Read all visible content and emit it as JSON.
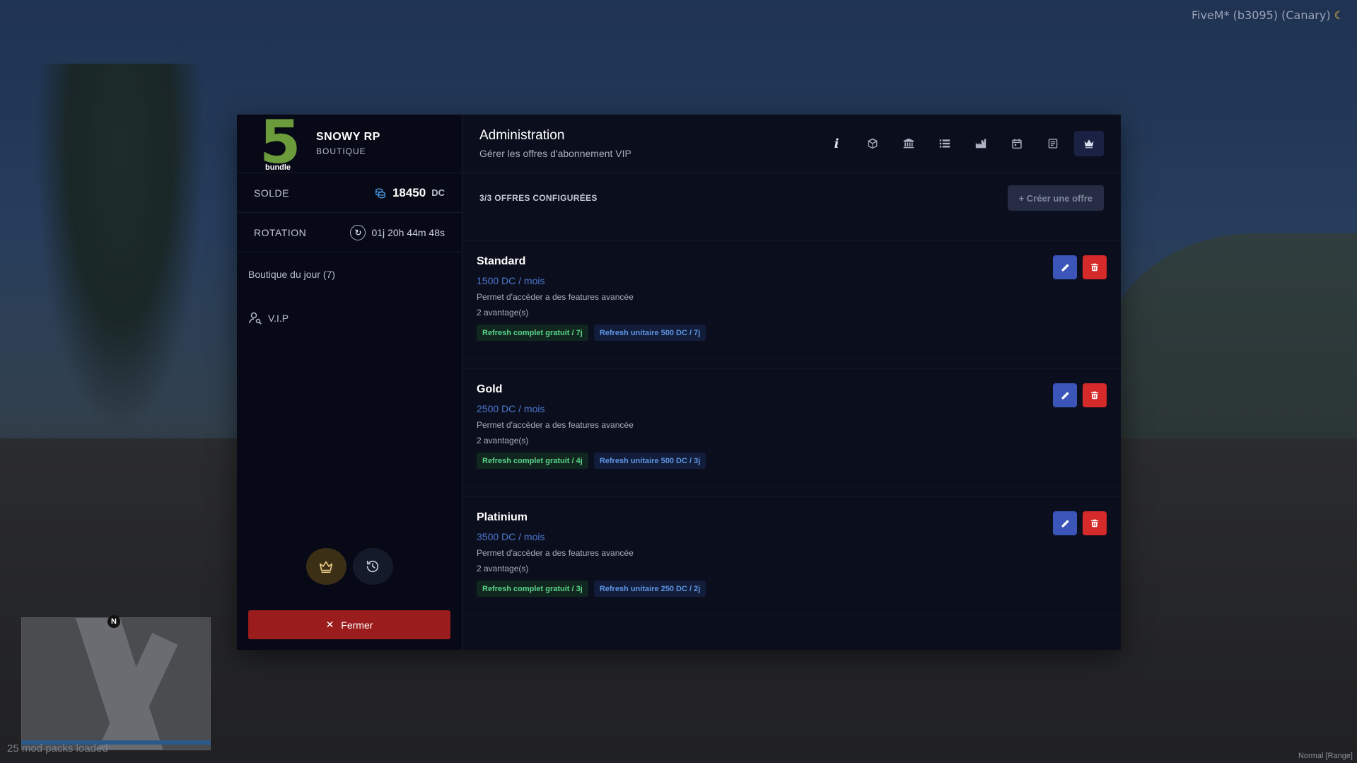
{
  "overlay": {
    "fivem_version": "FiveM* (b3095) (Canary)",
    "mod_status": "25 mod packs loaded",
    "bottom_right": "Normal [Range]",
    "minimap_north": "N"
  },
  "brand": {
    "logo_number": "5",
    "logo_word": "bundle",
    "title": "SNOWY RP",
    "subtitle": "BOUTIQUE"
  },
  "balance": {
    "label": "SOLDE",
    "value": "18450",
    "unit": "DC"
  },
  "rotation": {
    "label": "ROTATION",
    "value": "01j 20h 44m 48s"
  },
  "sidebar": {
    "items": [
      {
        "label": "Boutique du jour (7)"
      },
      {
        "label": "V.I.P"
      }
    ],
    "close_label": "Fermer"
  },
  "header": {
    "title": "Administration",
    "subtitle": "Gérer les offres d'abonnement VIP",
    "tools": [
      {
        "icon": "info-icon",
        "glyph": "i"
      },
      {
        "icon": "box-icon"
      },
      {
        "icon": "bank-icon"
      },
      {
        "icon": "list-icon"
      },
      {
        "icon": "factory-icon"
      },
      {
        "icon": "calendar-icon"
      },
      {
        "icon": "document-icon"
      },
      {
        "icon": "crown-icon",
        "active": true
      }
    ]
  },
  "offers_bar": {
    "count_label": "3/3 OFFRES CONFIGURÉES",
    "create_label": "+ Créer une offre"
  },
  "offers": [
    {
      "name": "Standard",
      "price": "1500 DC / mois",
      "description": "Permet d'accèder a des features avancée",
      "advantages": "2 avantage(s)",
      "tags": [
        "Refresh complet gratuit / 7j",
        "Refresh unitaire 500 DC / 7j"
      ]
    },
    {
      "name": "Gold",
      "price": "2500 DC / mois",
      "description": "Permet d'accèder a des features avancée",
      "advantages": "2 avantage(s)",
      "tags": [
        "Refresh complet gratuit / 4j",
        "Refresh unitaire 500 DC / 3j"
      ]
    },
    {
      "name": "Platinium",
      "price": "3500 DC / mois",
      "description": "Permet d'accèder a des features avancée",
      "advantages": "2 avantage(s)",
      "tags": [
        "Refresh complet gratuit / 3j",
        "Refresh unitaire 250 DC / 2j"
      ]
    }
  ],
  "colors": {
    "accent_blue": "#4d76d0",
    "edit_button": "#3b55b8",
    "delete_button": "#d42a2a",
    "close_button": "#9b1c1c",
    "logo_green": "#6b9b3a",
    "tag_green_text": "#5ad58a",
    "tag_blue_text": "#5f95e6"
  }
}
